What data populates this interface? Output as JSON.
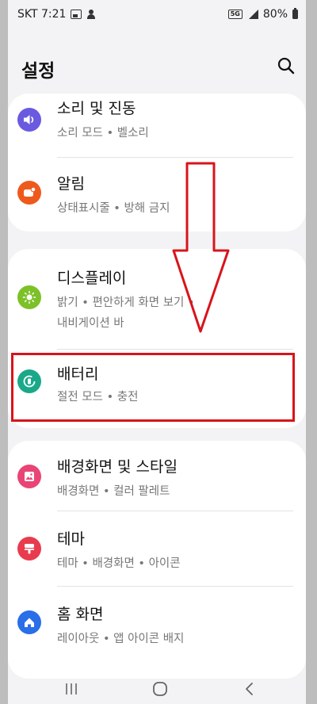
{
  "status": {
    "time": "SKT 7:21",
    "battery": "80%",
    "network": "5G"
  },
  "header": {
    "title": "설정"
  },
  "groups": [
    {
      "items": [
        {
          "title": "소리 및 진동",
          "subtitle": "소리 모드  •  벨소리",
          "icon": "speaker-icon",
          "color": "#6a5ae0"
        },
        {
          "title": "알림",
          "subtitle": "상태표시줄  •  방해 금지",
          "icon": "notification-icon",
          "color": "#ee5a1c"
        }
      ]
    },
    {
      "items": [
        {
          "title": "디스플레이",
          "subtitle": "밝기  •  편안하게 화면 보기  •",
          "subtitle2": "내비게이션 바",
          "icon": "sun-icon",
          "color": "#7cc128"
        },
        {
          "title": "배터리",
          "subtitle": "절전 모드  •  충전",
          "icon": "battery-icon",
          "color": "#1aa88a"
        }
      ]
    },
    {
      "items": [
        {
          "title": "배경화면 및 스타일",
          "subtitle": "배경화면  •  컬러 팔레트",
          "icon": "wallpaper-icon",
          "color": "#e84575"
        },
        {
          "title": "테마",
          "subtitle": "테마  •  배경화면  •  아이콘",
          "icon": "theme-icon",
          "color": "#e83c4e"
        },
        {
          "title": "홈 화면",
          "subtitle": "레이아웃  •  앱 아이콘 배지",
          "icon": "home-icon",
          "color": "#2a6ee8"
        }
      ]
    }
  ],
  "annotation": {
    "color": "#d8141c"
  }
}
